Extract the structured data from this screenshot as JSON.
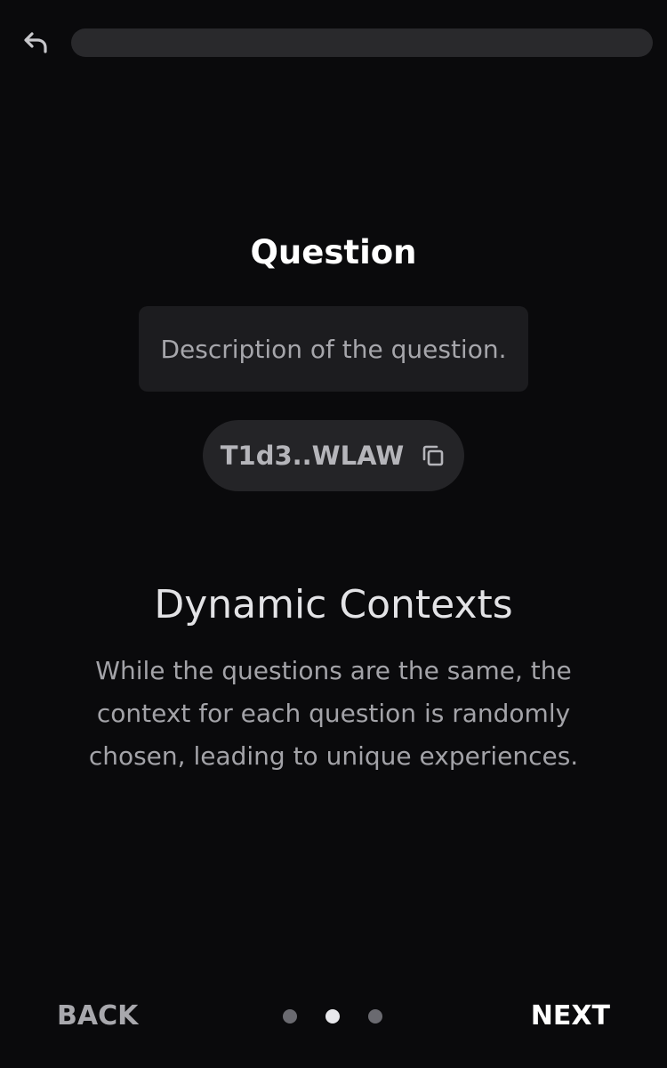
{
  "header": {
    "back_icon": "undo-arrow-icon",
    "progress": 0.0
  },
  "card": {
    "title": "Question",
    "description": "Description of the question.",
    "address": "T1d3..WLAW",
    "copy_icon": "copy-icon"
  },
  "feature": {
    "title": "Dynamic Contexts",
    "body": "While the questions are the same, the context for each question is randomly chosen, leading to unique experiences."
  },
  "footer": {
    "back_label": "BACK",
    "next_label": "NEXT",
    "pagination": {
      "total": 3,
      "active_index": 1
    }
  },
  "colors": {
    "background": "#0a0a0c",
    "surface": "#1c1c1f",
    "pill": "#242427",
    "dot_inactive": "#6a6a70",
    "dot_active": "#e8e8ec"
  }
}
